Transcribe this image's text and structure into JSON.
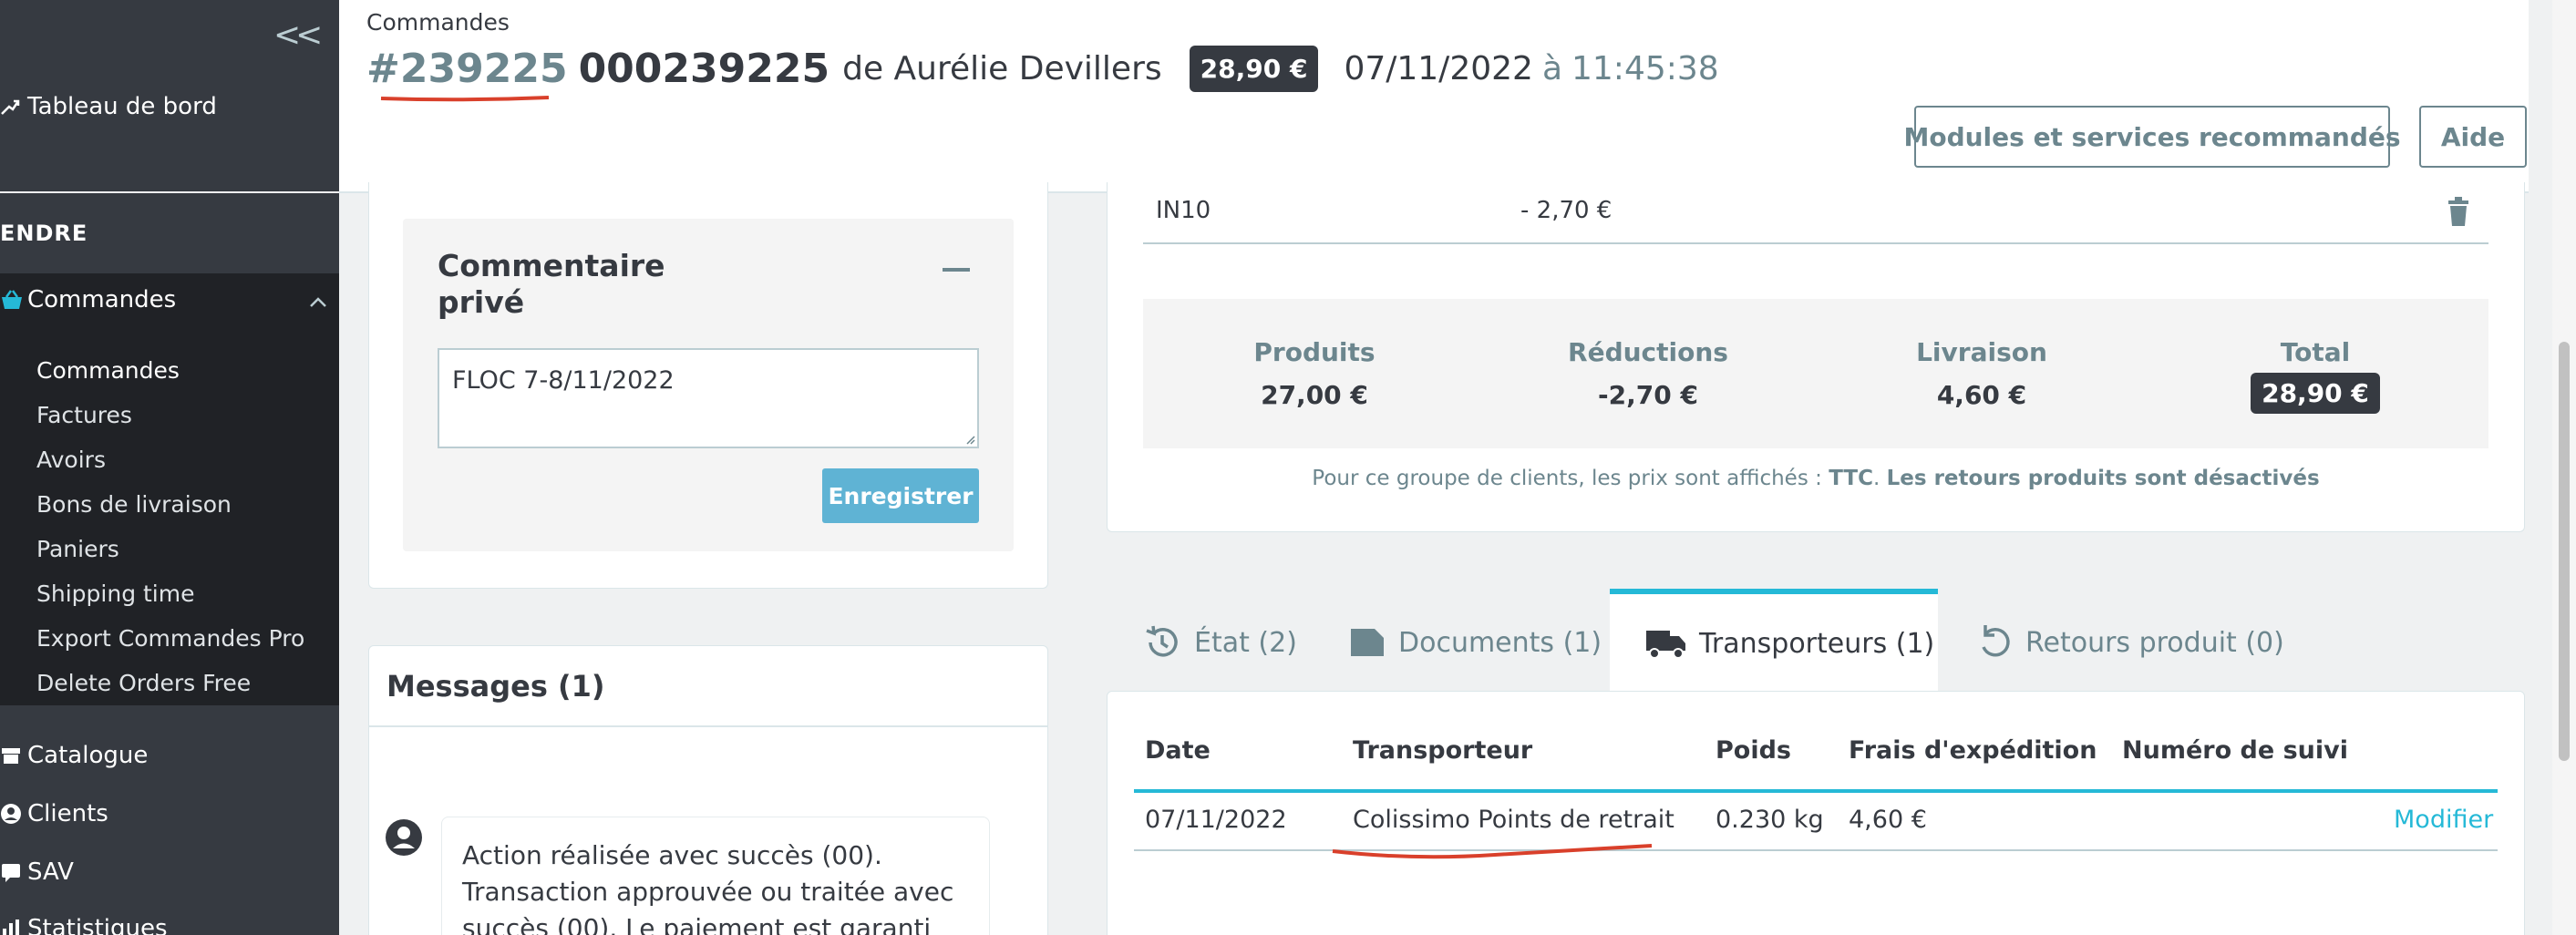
{
  "sidebar": {
    "collapse_glyph": "<<",
    "dashboard_label": "Tableau de bord",
    "section_label": "ENDRE",
    "orders_label": "Commandes",
    "sub_items": [
      "Commandes",
      "Factures",
      "Avoirs",
      "Bons de livraison",
      "Paniers",
      "Shipping time",
      "Export Commandes Pro",
      "Delete Orders Free"
    ],
    "catalog_label": "Catalogue",
    "clients_label": "Clients",
    "sav_label": "SAV",
    "stats_label": "Statistiques"
  },
  "header": {
    "breadcrumb": "Commandes",
    "order_ref": "#239225",
    "order_number": "000239225",
    "order_by": "de Aurélie Devillers",
    "total_badge": "28,90 €",
    "date": "07/11/2022",
    "at": "à",
    "time": "11:45:38",
    "modules_button": "Modules et services recommandés",
    "help_button": "Aide"
  },
  "comment": {
    "title": "Commentaire privé",
    "value": "FLOC 7-8/11/2022",
    "save_button": "Enregistrer"
  },
  "messages": {
    "title": "Messages (1)",
    "message_text": "Action réalisée avec succès (00). Transaction approuvée ou traitée avec succès (00). Le paiement est garanti (YES)."
  },
  "discount": {
    "code": "IN10",
    "value": "- 2,70 €"
  },
  "summary": {
    "products_label": "Produits",
    "products_value": "27,00 €",
    "reductions_label": "Réductions",
    "reductions_value": "-2,70 €",
    "shipping_label": "Livraison",
    "shipping_value": "4,60 €",
    "total_label": "Total",
    "total_value": "28,90 €",
    "note_prefix": "Pour ce groupe de clients, les prix sont affichés : ",
    "note_ttc": "TTC",
    "note_dot": ". ",
    "note_returns": "Les retours produits sont désactivés"
  },
  "tabs": [
    {
      "label": "État (2)",
      "icon": "history-icon"
    },
    {
      "label": "Documents (1)",
      "icon": "document-icon"
    },
    {
      "label": "Transporteurs (1)",
      "icon": "truck-icon"
    },
    {
      "label": "Retours produit (0)",
      "icon": "return-icon"
    }
  ],
  "carriers": {
    "headers": [
      "Date",
      "Transporteur",
      "Poids",
      "Frais d'expédition",
      "Numéro de suivi"
    ],
    "row": {
      "date": "07/11/2022",
      "carrier": "Colissimo Points de retrait",
      "weight": "0.230 kg",
      "shipping_cost": "4,60 €",
      "tracking": "",
      "action": "Modifier"
    }
  },
  "colors": {
    "sidebar_bg": "#363a41",
    "accent": "#25b9d7",
    "save_button": "#5fb3d4",
    "annotation_red": "#d9402b"
  }
}
